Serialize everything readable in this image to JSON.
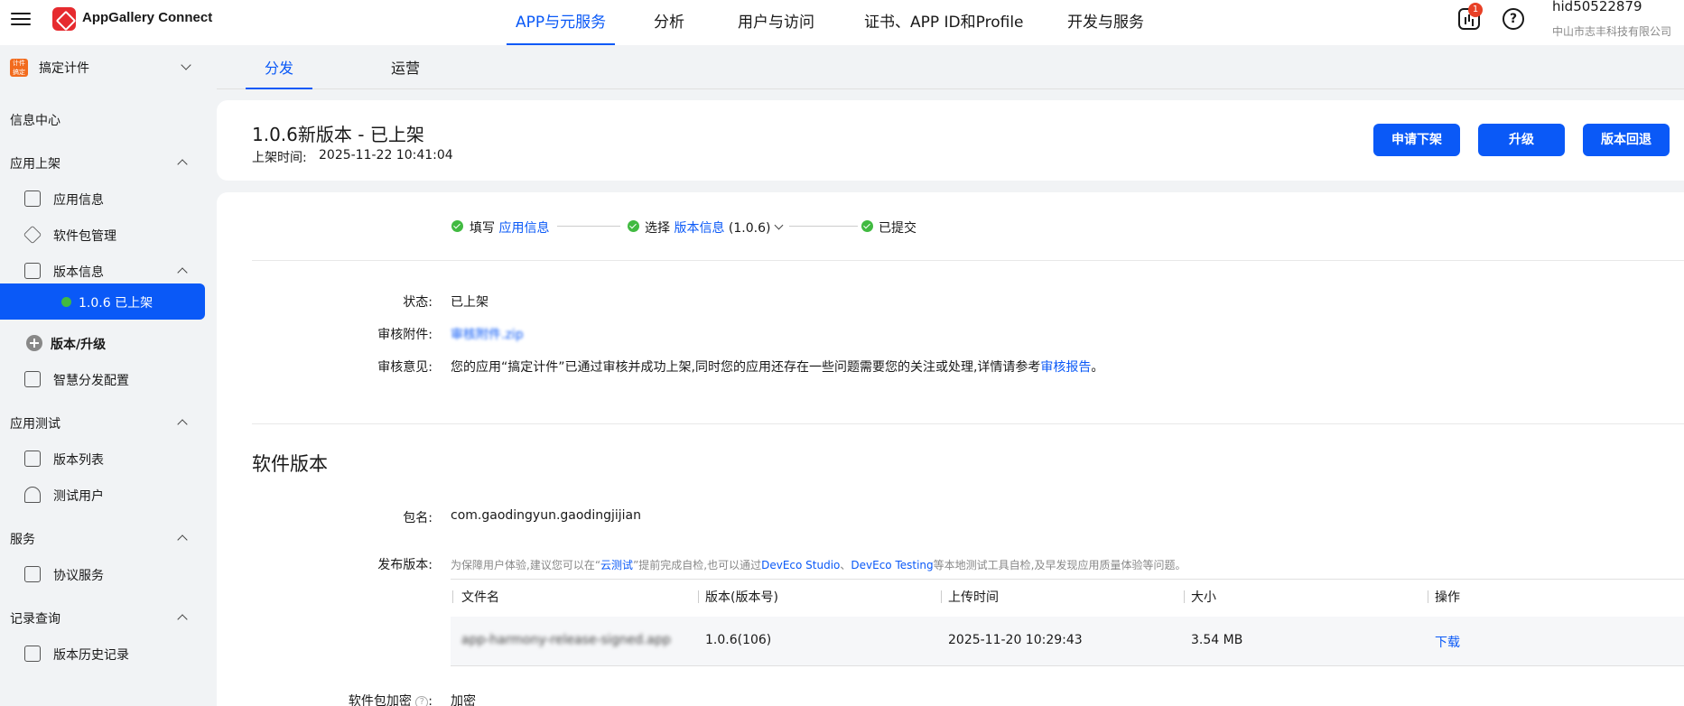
{
  "header": {
    "brand": "AppGallery Connect",
    "nav": [
      "APP与元服务",
      "分析",
      "用户与访问",
      "证书、APP ID和Profile",
      "开发与服务"
    ],
    "nav_active": 0,
    "badge_count": "1",
    "help_glyph": "?",
    "account_id": "hid50522879",
    "account_org": "中山市志丰科技有限公司"
  },
  "sidebar": {
    "app_icon_text": "计件\n搞定",
    "app_name": "搞定计件",
    "info_center": "信息中心",
    "group_publish": "应用上架",
    "app_info": "应用信息",
    "package_mgmt": "软件包管理",
    "version_info": "版本信息",
    "active_version": "1.0.6 已上架",
    "version_upgrade": "版本/升级",
    "smart_dist": "智慧分发配置",
    "group_test": "应用测试",
    "version_list": "版本列表",
    "test_users": "测试用户",
    "group_service": "服务",
    "agreement": "协议服务",
    "group_records": "记录查询",
    "version_history": "版本历史记录"
  },
  "tabs": [
    "分发",
    "运营"
  ],
  "version": {
    "title": "1.0.6新版本 - 已上架",
    "time_label": "上架时间:",
    "time_value": "2025-11-22 10:41:04",
    "buttons": [
      "申请下架",
      "升级",
      "版本回退"
    ]
  },
  "steps": {
    "s1_prefix": "填写",
    "s1_link": "应用信息",
    "s2_prefix": "选择",
    "s2_link": "版本信息",
    "s2_suffix": "(1.0.6)",
    "s3": "已提交"
  },
  "review": {
    "status_label": "状态:",
    "status_value": "已上架",
    "attach_label": "审核附件:",
    "attach_value": "审核附件.zip",
    "opinion_label": "审核意见:",
    "opinion_text": "您的应用“搞定计件”已通过审核并成功上架,同时您的应用还存在一些问题需要您的关注或处理,详情请参考",
    "opinion_link": "审核报告",
    "opinion_end": "。"
  },
  "software": {
    "section_title": "软件版本",
    "package_label": "包名:",
    "package_value": "com.gaodingyun.gaodingjijian",
    "release_label": "发布版本:",
    "hint_a": "为保障用户体验,建议您可以在“",
    "hint_link1": "云测试",
    "hint_b": "”提前完成自检,也可以通过",
    "hint_link2": "DevEco Studio",
    "hint_c": "、",
    "hint_link3": "DevEco Testing",
    "hint_d": "等本地测试工具自检,及早发现应用质量体验等问题。",
    "columns": [
      "文件名",
      "版本(版本号)",
      "上传时间",
      "大小",
      "操作"
    ],
    "rows": [
      {
        "file": "app-harmony-release-signed.app",
        "version": "1.0.6(106)",
        "uploaded": "2025-11-20 10:29:43",
        "size": "3.54 MB",
        "action": "下载"
      }
    ],
    "encrypt_label": "软件包加密",
    "encrypt_help": "?",
    "encrypt_colon": ":",
    "encrypt_value": "加密"
  },
  "colors": {
    "accent": "#0a59f7",
    "success": "#41ba41",
    "brand": "#e62b2f",
    "badge": "#e84026"
  }
}
